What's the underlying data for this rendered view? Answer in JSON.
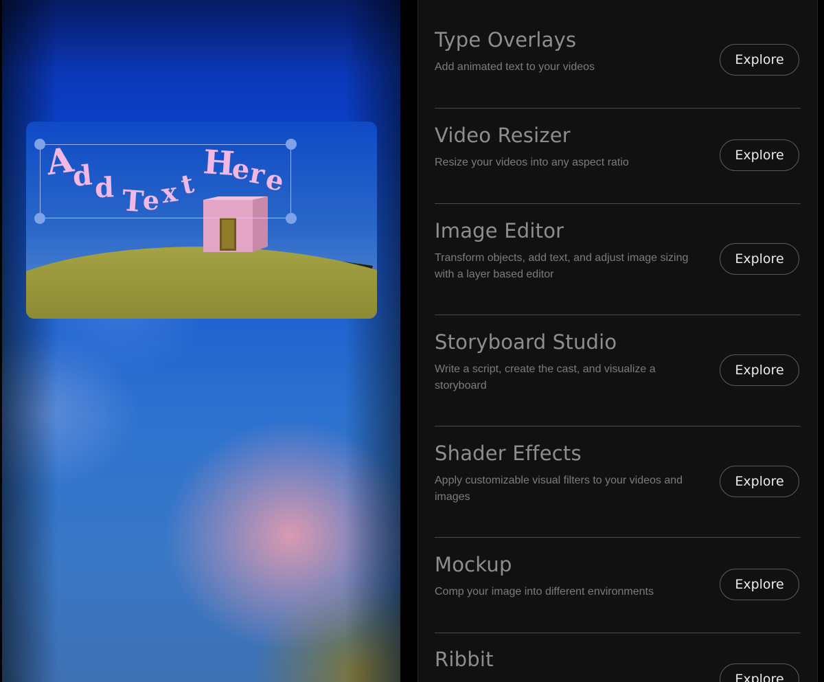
{
  "preview": {
    "overlay_text": [
      "A",
      "d",
      "d",
      "T",
      "e",
      "x",
      "t",
      "H",
      "e",
      "r",
      "e"
    ]
  },
  "tools": [
    {
      "title": "Type Overlays",
      "description": "Add animated text to your videos",
      "button": "Explore"
    },
    {
      "title": "Video Resizer",
      "description": "Resize your videos into any aspect ratio",
      "button": "Explore"
    },
    {
      "title": "Image Editor",
      "description": "Transform objects, add text, and adjust image sizing with a layer based editor",
      "button": "Explore"
    },
    {
      "title": "Storyboard Studio",
      "description": "Write a script, create the cast, and visualize a storyboard",
      "button": "Explore"
    },
    {
      "title": "Shader Effects",
      "description": "Apply customizable visual filters to your videos and images",
      "button": "Explore"
    },
    {
      "title": "Mockup",
      "description": "Comp your image into different environments",
      "button": "Explore"
    },
    {
      "title": "Ribbit",
      "description": "",
      "button": "Explore"
    }
  ],
  "colors": {
    "panel_bg": "#111111",
    "title": "#8e8e8e",
    "description": "#7c7c7c",
    "button_text": "#ececec",
    "overlay_text": "#f2b8e4",
    "house": "#e3a6c6",
    "hill": "#9c9a3e"
  }
}
